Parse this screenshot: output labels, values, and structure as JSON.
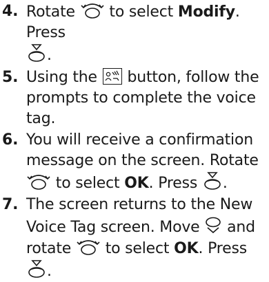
{
  "steps": [
    {
      "num": "4.",
      "t1": "Rotate",
      "t2": "to select",
      "b1": "Modify",
      "t3": ". Press",
      "t4": "."
    },
    {
      "num": "5.",
      "t1": "Using the",
      "t2": "button, follow the prompts to complete the voice tag."
    },
    {
      "num": "6.",
      "t1": "You will receive a confirmation message on the screen. Rotate",
      "t2": "to select",
      "b1": "OK",
      "t3": ". Press",
      "t4": "."
    },
    {
      "num": "7.",
      "t1": "The screen returns to the New Voice Tag screen. Move",
      "t2": "and rotate",
      "t3": "to select",
      "b1": "OK",
      "t4": ". Press",
      "t5": "."
    }
  ],
  "icons": {
    "rotate": "interface-dial-rotate-icon",
    "press": "interface-dial-press-icon",
    "talk": "talk-button-icon",
    "move": "interface-dial-move-down-icon"
  }
}
